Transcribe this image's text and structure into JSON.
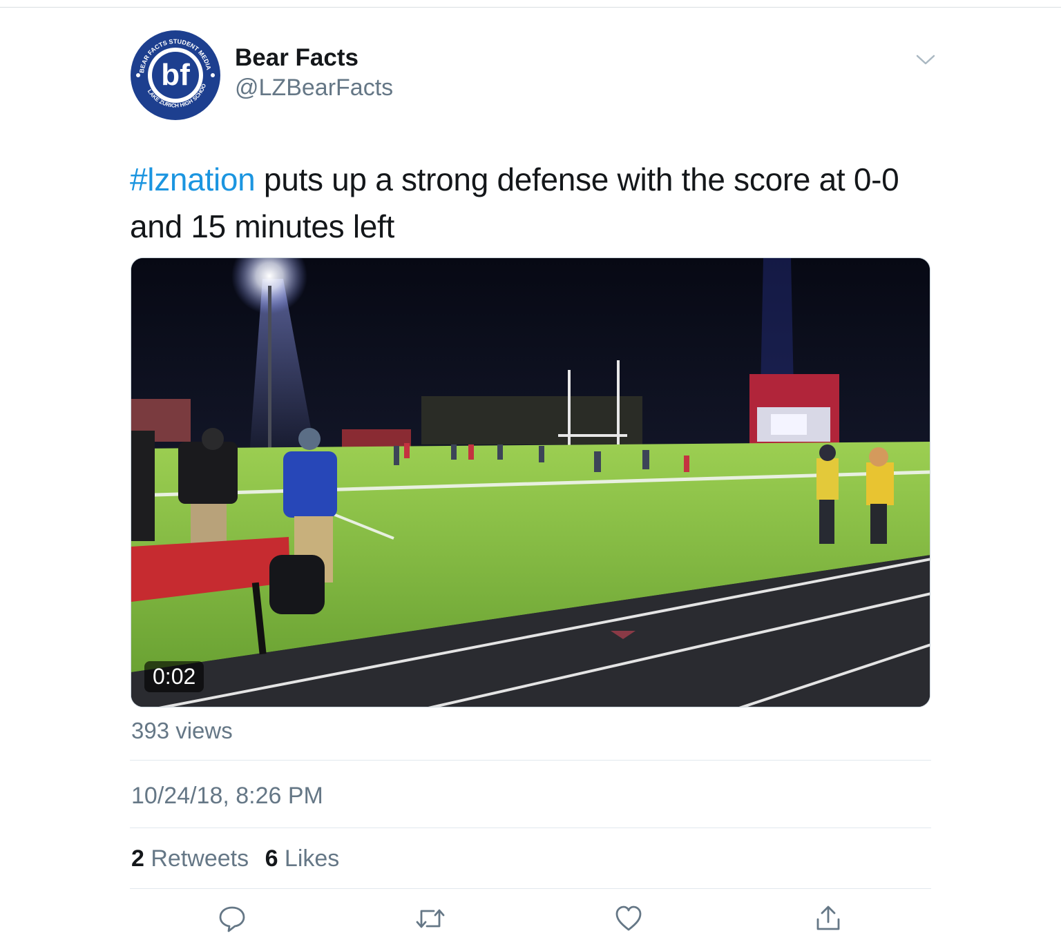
{
  "header": {
    "avatar_outer_text": "BEAR FACTS STUDENT MEDIA",
    "avatar_inner_text": "bf",
    "avatar_bottom_text": "LAKE ZURICH HIGH SCHOOL",
    "display_name": "Bear Facts",
    "handle": "@LZBearFacts"
  },
  "tweet": {
    "hashtag": "#lznation",
    "text": " puts up a strong defense with the score at 0-0 and 15 minutes left"
  },
  "video": {
    "duration": "0:02",
    "views": "393 views"
  },
  "meta": {
    "timestamp": "10/24/18, 8:26 PM"
  },
  "stats": {
    "retweets_count": "2",
    "retweets_label": " Retweets",
    "likes_count": "6",
    "likes_label": " Likes"
  },
  "actions": [
    "reply-icon",
    "retweet-icon",
    "like-icon",
    "share-icon"
  ],
  "colors": {
    "hashtag": "#1b95e0",
    "secondary_text": "#657786",
    "brand_blue": "#1d3f8f"
  }
}
